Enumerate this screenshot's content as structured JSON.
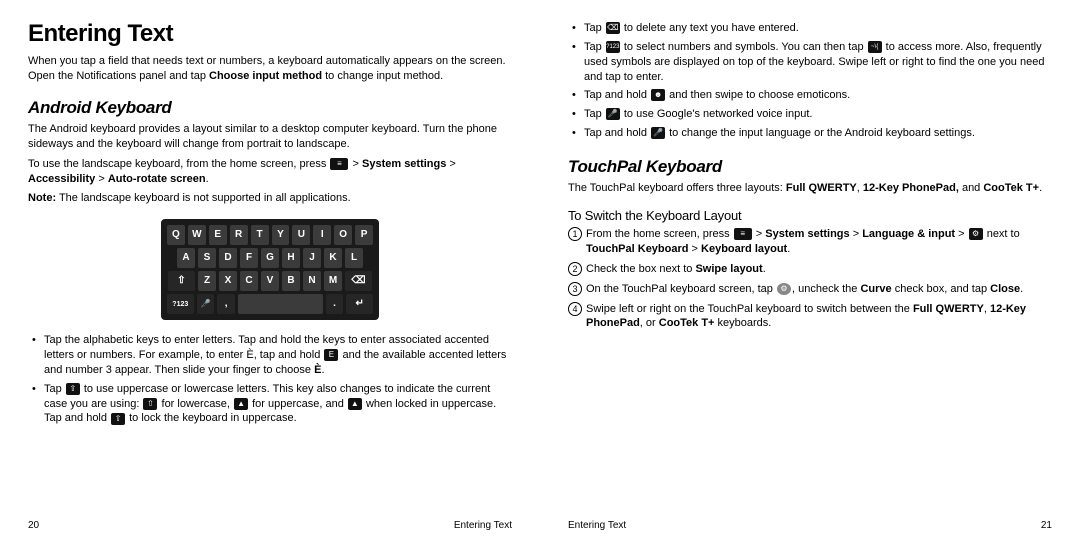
{
  "left": {
    "h1": "Entering Text",
    "intro_a": "When you tap a field that needs text or numbers, a keyboard automatically appears on the screen. Open the Notifications panel and tap ",
    "intro_b": "Choose input method",
    "intro_c": " to change input method.",
    "h2": "Android Keyboard",
    "p1": "The Android keyboard provides a layout similar to a desktop computer keyboard. Turn the phone sideways and the keyboard will change from portrait to landscape.",
    "p2a": "To use the landscape keyboard, from the home screen, press ",
    "p2b": "System settings",
    "p2c": "Accessibility",
    "p2d": "Auto-rotate screen",
    "note_label": "Note:",
    "note": " The landscape keyboard is not supported in all applications.",
    "kbd": {
      "r1": [
        "Q",
        "W",
        "E",
        "R",
        "T",
        "Y",
        "U",
        "I",
        "O",
        "P"
      ],
      "r2": [
        "A",
        "S",
        "D",
        "F",
        "G",
        "H",
        "J",
        "K",
        "L"
      ],
      "r3_shift": "⇧",
      "r3": [
        "Z",
        "X",
        "C",
        "V",
        "B",
        "N",
        "M"
      ],
      "r3_del": "⌫",
      "r4_sym": "?123",
      "r4_mic": "🎤",
      "r4_comma": ",",
      "r4_dot": ".",
      "r4_enter": "↵"
    },
    "b1a": "Tap the alphabetic keys to enter letters. Tap and hold the keys to enter associated accented letters or numbers. For example, to enter È, tap and hold ",
    "b1key": "E",
    "b1b": " and the available accented letters and number 3 appear. Then slide your finger to choose ",
    "b1c": "È",
    "b1d": ".",
    "b2a": "Tap ",
    "b2b": " to use uppercase or lowercase letters. This key also changes to indicate the current case you are using: ",
    "b2c": " for lowercase, ",
    "b2d": " for uppercase, and ",
    "b2e": " when locked in uppercase. Tap and hold ",
    "b2f": " to lock the keyboard in uppercase.",
    "page_no": "20",
    "page_title": "Entering Text"
  },
  "right": {
    "c1a": "Tap ",
    "c1b": " to delete any text you have entered.",
    "c2a": "Tap ",
    "c2b": " to select numbers and symbols. You can then tap ",
    "c2c": " to access more. Also, frequently used symbols are displayed on top of the keyboard. Swipe left or right to find the one you need and tap to enter.",
    "c3a": "Tap and hold ",
    "c3b": " and then swipe to choose emoticons.",
    "c4a": "Tap ",
    "c4b": " to use Google's networked voice input.",
    "c5a": "Tap and hold ",
    "c5b": " to change the input language or the Android keyboard settings.",
    "h2": "TouchPal Keyboard",
    "p1a": "The TouchPal keyboard offers three layouts: ",
    "p1b": "Full QWERTY",
    "p1c": "12-Key PhonePad,",
    "p1d": "CooTek T+",
    "h3": "To Switch the Keyboard Layout",
    "s1a": "From the home screen, press ",
    "s1b": "System settings",
    "s1c": "Language & input",
    "s1d": " next to ",
    "s1e": "TouchPal Keyboard",
    "s1f": "Keyboard layout",
    "s2a": "Check the box next to ",
    "s2b": "Swipe layout",
    "s3a": "On the TouchPal keyboard screen, tap ",
    "s3b": ", uncheck the ",
    "s3c": "Curve",
    "s3d": " check box, and tap ",
    "s3e": "Close",
    "s4a": "Swipe left or right on the TouchPal keyboard to switch between the ",
    "s4b": "Full QWERTY",
    "s4c": "12-Key PhonePad",
    "s4d": "CooTek T+",
    "s4e": " keyboards.",
    "page_title": "Entering Text",
    "page_no": "21"
  }
}
